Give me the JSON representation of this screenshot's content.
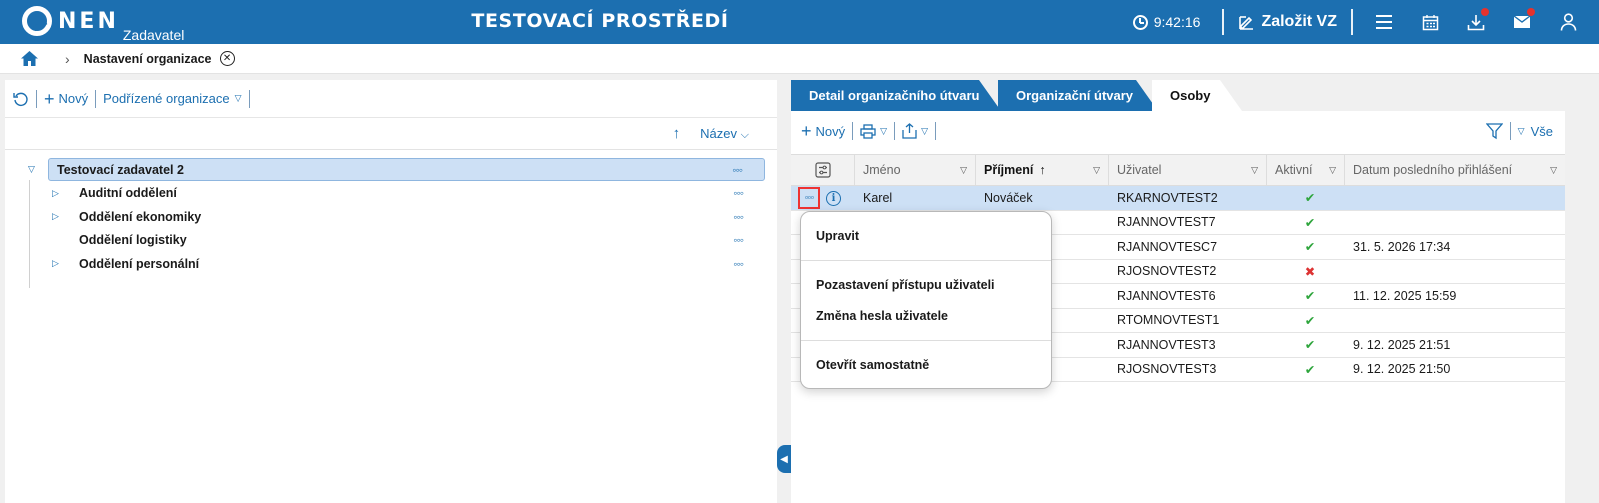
{
  "app": {
    "logo_text": "NEN",
    "logo_sub": "Zadavatel",
    "environment_title": "TESTOVACÍ PROSTŘEDÍ",
    "clock": "9:42:16",
    "create_vz": "Založit VZ",
    "accent": "#1c6fb0"
  },
  "breadcrumb": {
    "page": "Nastavení organizace"
  },
  "left": {
    "toolbar": {
      "new": "Nový",
      "subordinate": "Podřízené organizace"
    },
    "sort_label": "Název",
    "tree": {
      "root": "Testovací zadavatel 2",
      "children": [
        "Auditní oddělení",
        "Oddělení ekonomiky",
        "Oddělení logistiky",
        "Oddělení personální"
      ]
    }
  },
  "right": {
    "tabs": [
      "Detail organizačního útvaru",
      "Organizační útvary",
      "Osoby"
    ],
    "active_tab": "Osoby",
    "toolbar": {
      "new": "Nový",
      "filter_all": "Vše"
    },
    "grid": {
      "columns": [
        "Jméno",
        "Příjmení",
        "Uživatel",
        "Aktivní",
        "Datum posledního přihlášení"
      ],
      "rows": [
        {
          "first": "Karel",
          "last": "Nováček",
          "user": "RKARNOVTEST2",
          "active": true,
          "last_login": ""
        },
        {
          "first": "",
          "last": "",
          "user": "RJANNOVTEST7",
          "active": true,
          "last_login": ""
        },
        {
          "first": "",
          "last": "",
          "user": "RJANNOVTESC7",
          "active": true,
          "last_login": "31. 5. 2026 17:34"
        },
        {
          "first": "",
          "last": "",
          "user": "RJOSNOVTEST2",
          "active": false,
          "last_login": ""
        },
        {
          "first": "",
          "last": "",
          "user": "RJANNOVTEST6",
          "active": true,
          "last_login": "11. 12. 2025 15:59"
        },
        {
          "first": "",
          "last": "",
          "user": "RTOMNOVTEST1",
          "active": true,
          "last_login": ""
        },
        {
          "first": "",
          "last": "",
          "user": "RJANNOVTEST3",
          "active": true,
          "last_login": "9. 12. 2025 21:51"
        },
        {
          "first": "",
          "last": "",
          "user": "RJOSNOVTEST3",
          "active": true,
          "last_login": "9. 12. 2025 21:50"
        }
      ]
    }
  },
  "context_menu": {
    "items": [
      "Upravit",
      "Pozastavení přístupu uživateli",
      "Změna hesla uživatele",
      "Otevřít samostatně"
    ]
  }
}
